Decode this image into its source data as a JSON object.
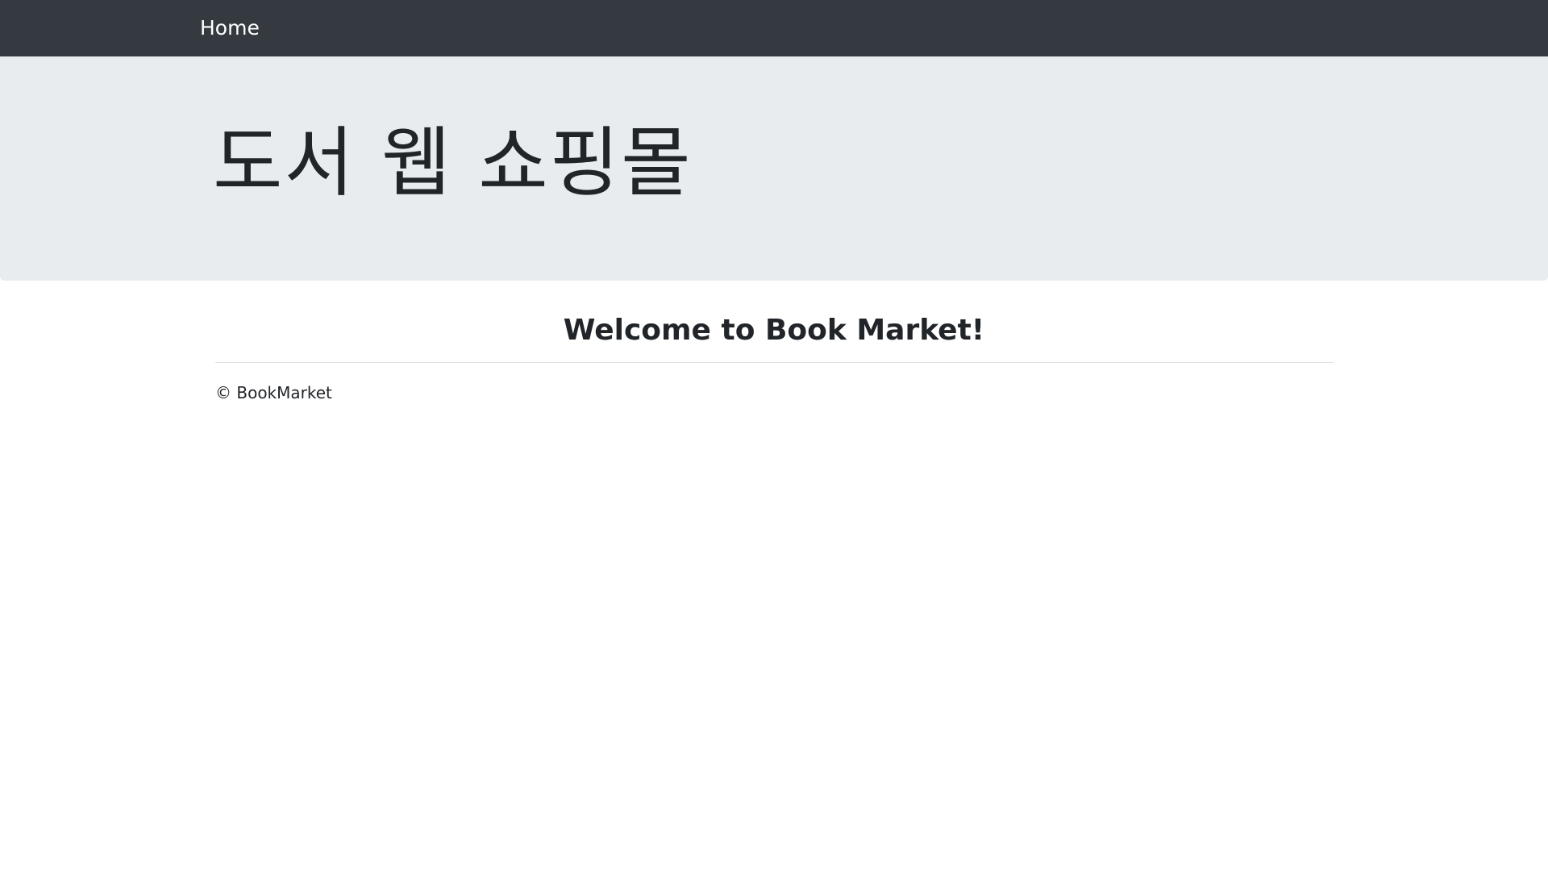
{
  "navbar": {
    "home_label": "Home"
  },
  "jumbotron": {
    "title": "도서 웹 쇼핑몰"
  },
  "main": {
    "welcome_text": "Welcome to Book Market!"
  },
  "footer": {
    "copyright_text": "© BookMarket"
  },
  "colors": {
    "navbar_bg": "#343a40",
    "jumbotron_bg": "#e9ecef",
    "text": "#212529",
    "divider": "#dee2e6"
  }
}
